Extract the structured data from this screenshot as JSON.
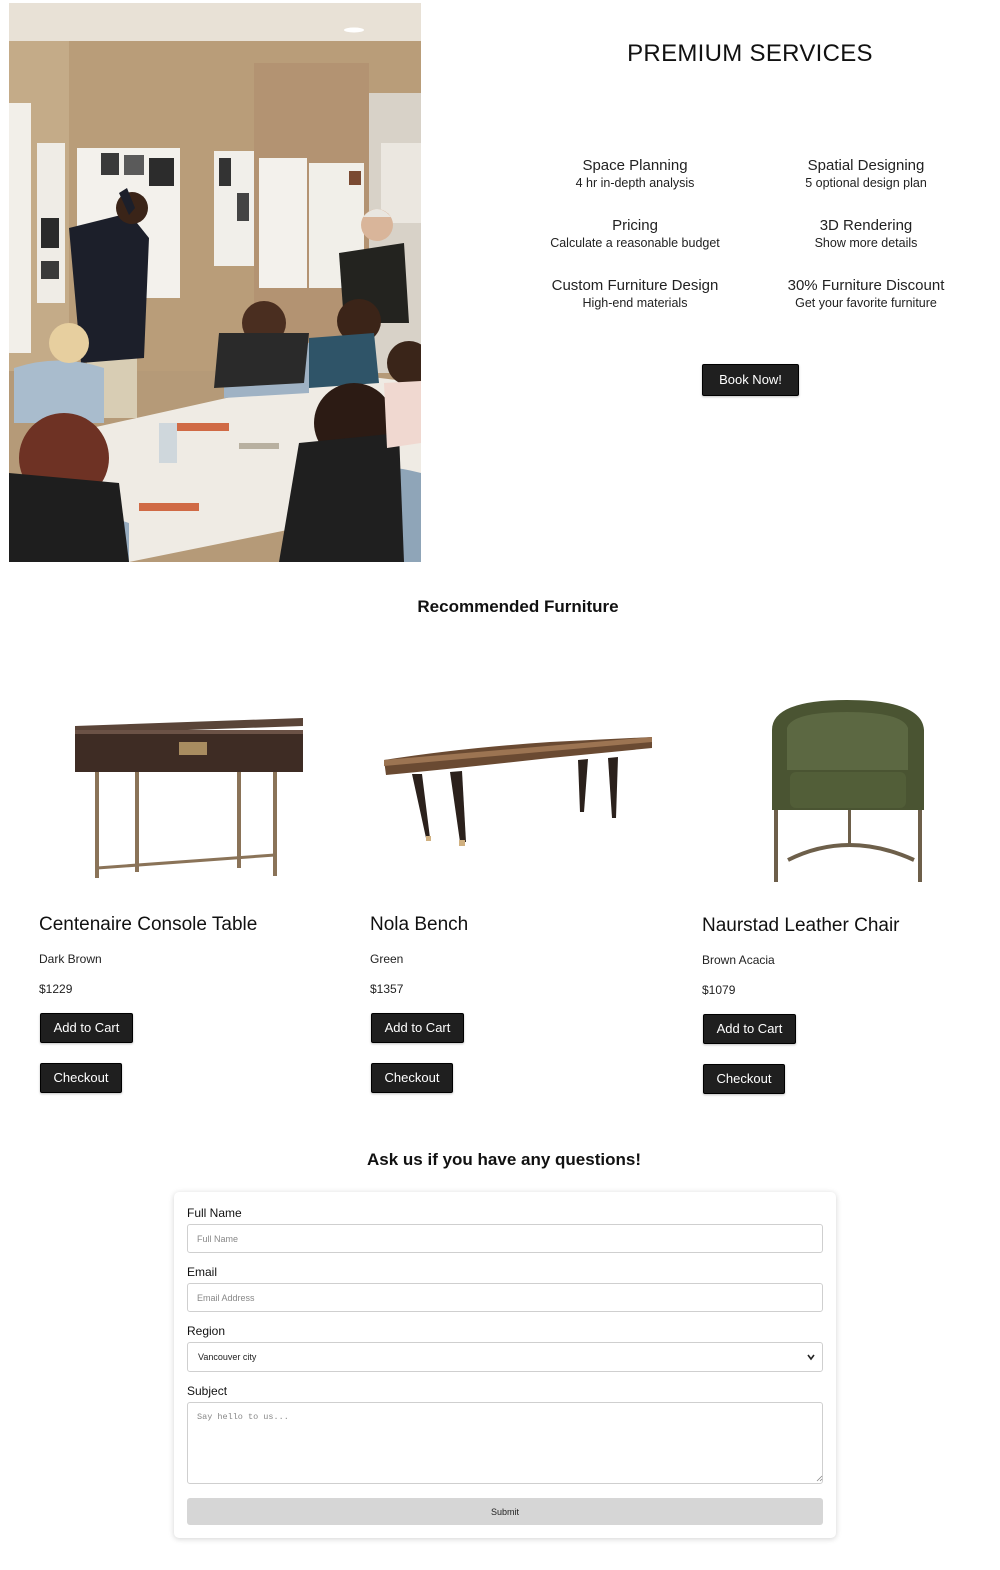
{
  "services": {
    "title": "PREMIUM SERVICES",
    "items": [
      {
        "title": "Space Planning",
        "subtitle": "4 hr in-depth analysis"
      },
      {
        "title": "Spatial Designing",
        "subtitle": "5 optional design plan"
      },
      {
        "title": "Pricing",
        "subtitle": "Calculate a reasonable budget"
      },
      {
        "title": "3D Rendering",
        "subtitle": "Show more details"
      },
      {
        "title": "Custom Furniture Design",
        "subtitle": "High-end materials"
      },
      {
        "title": "30% Furniture Discount",
        "subtitle": "Get your favorite furniture"
      }
    ],
    "book_label": "Book Now!"
  },
  "recommended": {
    "title": "Recommended Furniture",
    "products": [
      {
        "name": "Centenaire Console Table",
        "color": "Dark Brown",
        "price": "$1229",
        "add_label": "Add to Cart",
        "checkout_label": "Checkout"
      },
      {
        "name": "Nola Bench",
        "color": "Green",
        "price": "$1357",
        "add_label": "Add to Cart",
        "checkout_label": "Checkout"
      },
      {
        "name": "Naurstad Leather Chair",
        "color": "Brown Acacia",
        "price": "$1079",
        "add_label": "Add to Cart",
        "checkout_label": "Checkout"
      }
    ]
  },
  "contact": {
    "title": "Ask us if you have any questions!",
    "name_label": "Full Name",
    "name_placeholder": "Full Name",
    "email_label": "Email",
    "email_placeholder": "Email Address",
    "region_label": "Region",
    "region_value": "Vancouver city",
    "subject_label": "Subject",
    "subject_placeholder": "Say hello to us...",
    "submit_label": "Submit"
  },
  "colors": {
    "button_bg": "#1f1f1f",
    "button_text": "#ffffff",
    "submit_bg": "#d6d6d6"
  }
}
